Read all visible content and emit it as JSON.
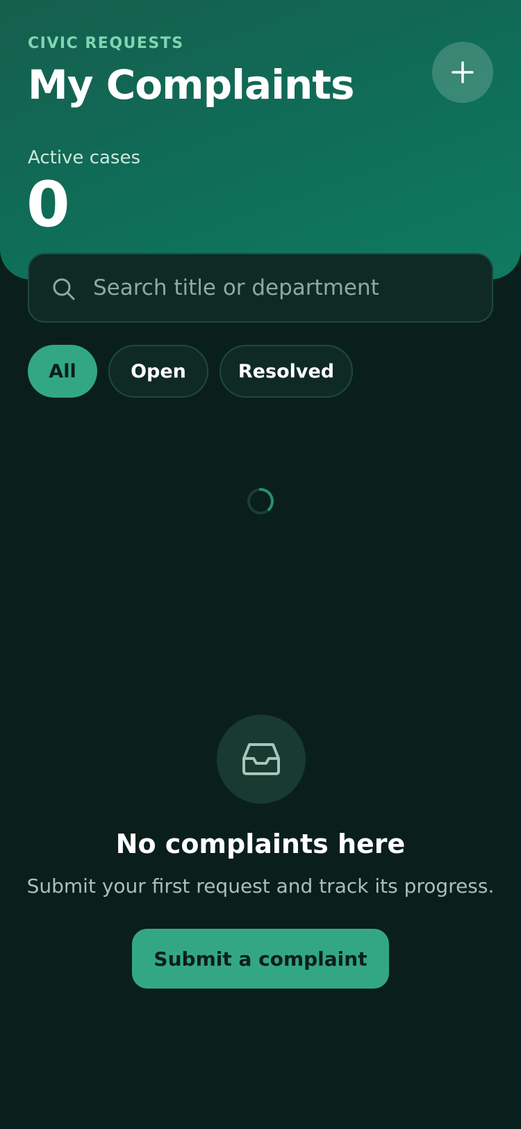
{
  "header": {
    "eyebrow": "CIVIC REQUESTS",
    "title": "My Complaints",
    "add_icon": "plus-icon",
    "stats": {
      "label": "Active cases",
      "value": "0"
    }
  },
  "search": {
    "icon": "search-icon",
    "placeholder": "Search title or department",
    "value": ""
  },
  "filters": {
    "selected": "All",
    "items": [
      {
        "label": "All"
      },
      {
        "label": "Open"
      },
      {
        "label": "Resolved"
      }
    ]
  },
  "loading_icon": "loading-spinner-icon",
  "empty_state": {
    "icon": "inbox-icon",
    "title": "No complaints here",
    "subtitle": "Submit your first request and track its progress.",
    "cta_label": "Submit a complaint"
  },
  "colors": {
    "background": "#0a1f1b",
    "header_gradient_start": "#165e4e",
    "header_gradient_end": "#107a61",
    "accent": "#33a784",
    "eyebrow": "#7fd6b3",
    "surface": "#0f2a24",
    "border": "#1d4a3e"
  }
}
